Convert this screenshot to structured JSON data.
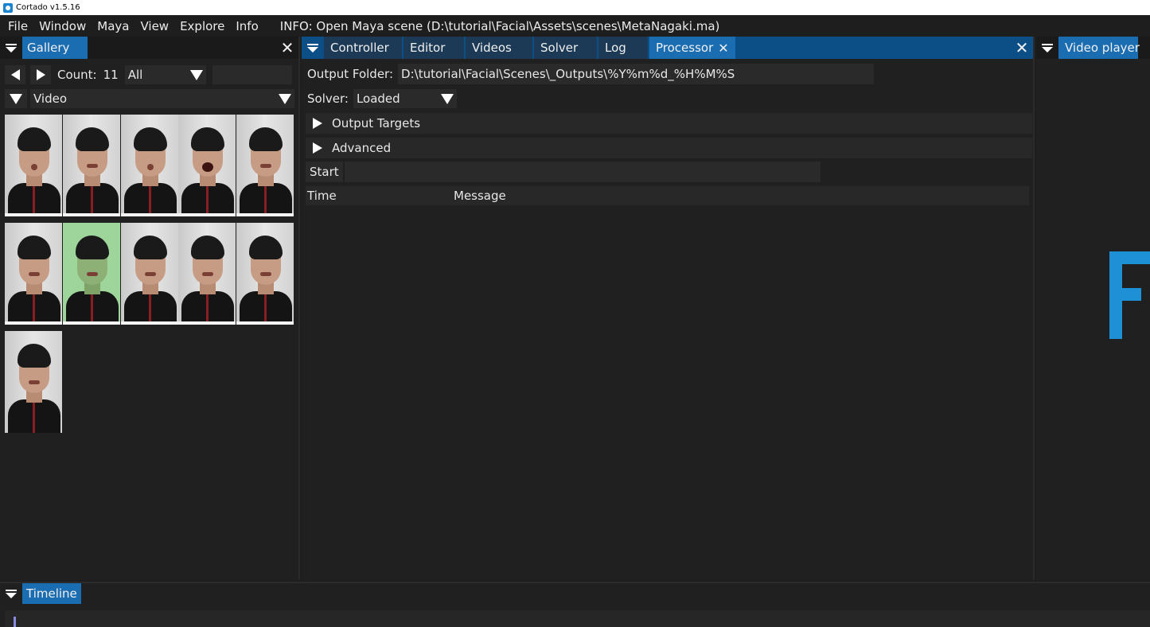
{
  "window": {
    "title": "Cortado v1.5.16"
  },
  "menubar": {
    "items": [
      "File",
      "Window",
      "Maya",
      "View",
      "Explore",
      "Info"
    ],
    "info_message": "INFO: Open Maya scene (D:\\tutorial\\Facial\\Assets\\scenes\\MetaNagaki.ma)"
  },
  "gallery": {
    "tab_label": "Gallery",
    "count_label": "Count:",
    "count_value": "11",
    "filter_value": "All",
    "type_value": "Video",
    "thumbnails": [
      {
        "state": "normal",
        "expression": "pucker"
      },
      {
        "state": "normal",
        "expression": "smile"
      },
      {
        "state": "normal",
        "expression": "pucker"
      },
      {
        "state": "normal",
        "expression": "open"
      },
      {
        "state": "normal",
        "expression": "neutral"
      },
      {
        "state": "normal",
        "expression": "squint"
      },
      {
        "state": "selected",
        "expression": "neutral"
      },
      {
        "state": "normal",
        "expression": "neutral"
      },
      {
        "state": "normal",
        "expression": "neutral"
      },
      {
        "state": "normal",
        "expression": "neutral"
      },
      {
        "state": "normal",
        "expression": "neutral"
      }
    ]
  },
  "main": {
    "tabs": [
      {
        "label": "Controller",
        "active": false
      },
      {
        "label": "Editor",
        "active": false
      },
      {
        "label": "Videos",
        "active": false
      },
      {
        "label": "Solver",
        "active": false
      },
      {
        "label": "Log",
        "active": false
      },
      {
        "label": "Processor",
        "active": true
      }
    ],
    "output_folder_label": "Output Folder:",
    "output_folder_value": "D:\\tutorial\\Facial\\Scenes\\_Outputs\\%Y%m%d_%H%M%S",
    "solver_label": "Solver:",
    "solver_value": "Loaded",
    "sections": [
      "Output Targets",
      "Advanced"
    ],
    "start_label": "Start",
    "log_columns": [
      "Time",
      "Message"
    ]
  },
  "video_player": {
    "tab_label": "Video player"
  },
  "timeline": {
    "tab_label": "Timeline"
  },
  "colors": {
    "accent": "#1b6db2",
    "tabbar_active": "#0c4f86",
    "background": "#1e1e1e",
    "logo": "#1e90d6"
  }
}
